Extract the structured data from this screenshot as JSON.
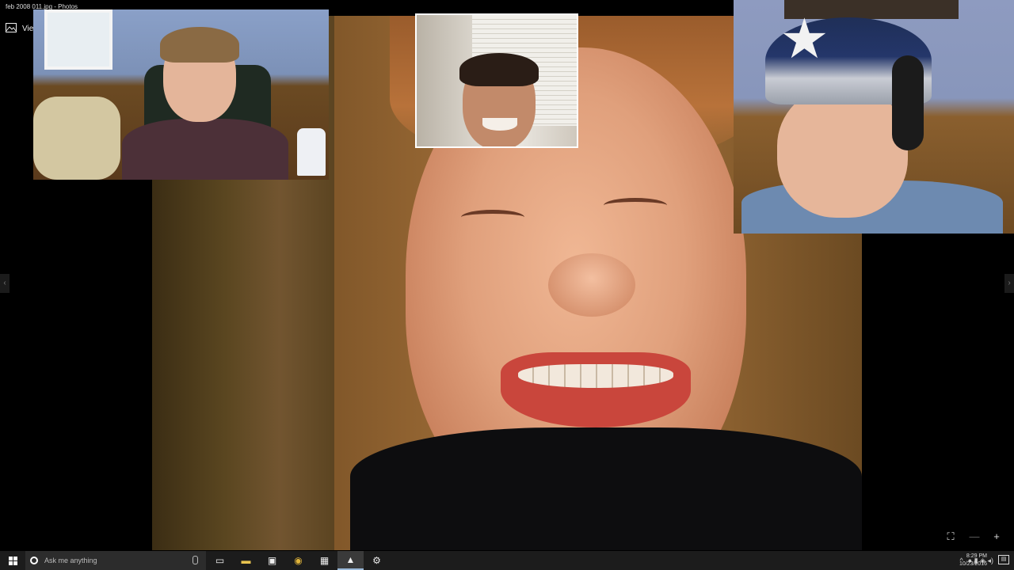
{
  "window": {
    "title": "feb 2008 011.jpg - Photos",
    "toolbar_label": "View"
  },
  "viewer": {
    "prev_arrow": "‹",
    "next_arrow": "›",
    "controls": {
      "crop": "⛶",
      "zoom_out": "—",
      "zoom_in": "+"
    }
  },
  "taskbar": {
    "search_placeholder": "Ask me anything",
    "apps": [
      {
        "name": "task-view",
        "glyph": "▭"
      },
      {
        "name": "file-explorer",
        "glyph": "▬"
      },
      {
        "name": "store",
        "glyph": "▣"
      },
      {
        "name": "chrome",
        "glyph": "◉"
      },
      {
        "name": "media",
        "glyph": "▦"
      },
      {
        "name": "photos",
        "glyph": "▲"
      },
      {
        "name": "settings",
        "glyph": "⚙"
      }
    ],
    "tray": {
      "chevron": "^",
      "icons": "● ▮ ◈ ◂)"
    },
    "clock": {
      "time": "8:29 PM",
      "date": "10/23/2016"
    },
    "notifications": "▤"
  }
}
